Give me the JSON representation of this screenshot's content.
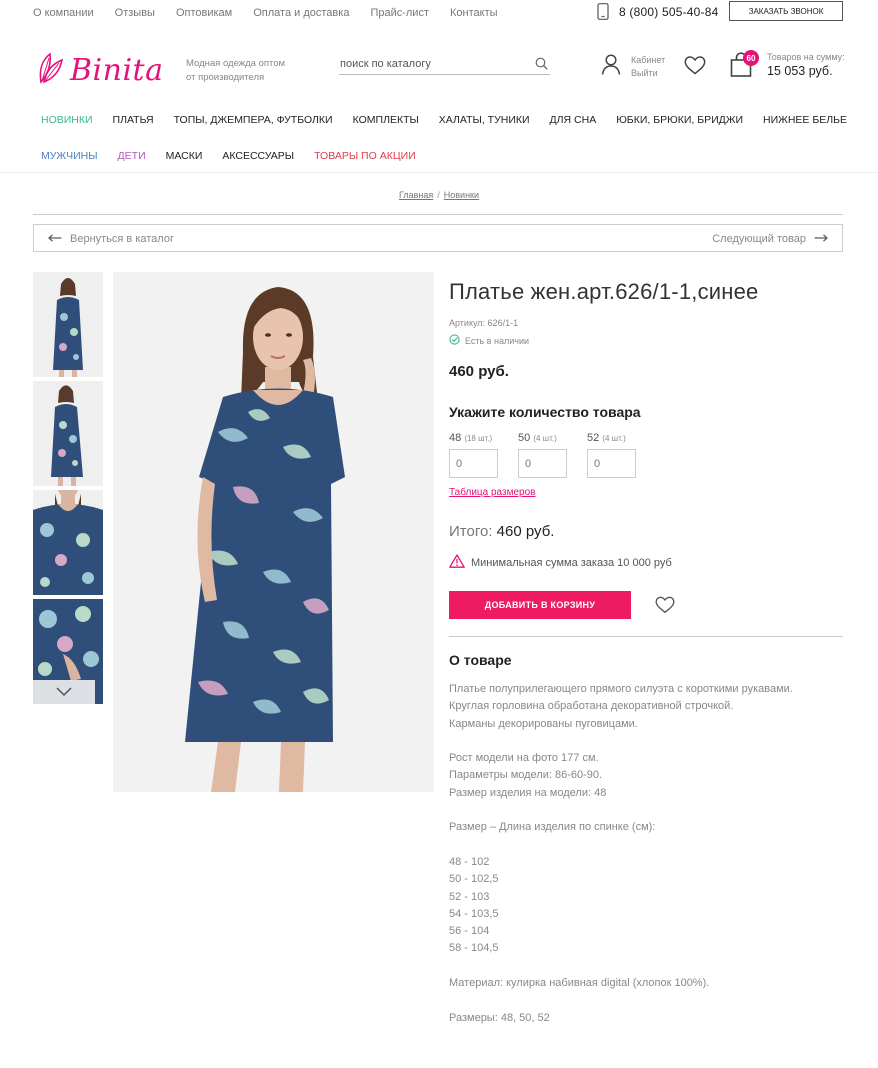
{
  "topbar": {
    "links": [
      "О компании",
      "Отзывы",
      "Оптовикам",
      "Оплата и доставка",
      "Прайс-лист",
      "Контакты"
    ],
    "phone": "8 (800) 505-40-84",
    "callback": "Заказать звонок"
  },
  "header": {
    "logo": "Binita",
    "tagline": "Модная одежда оптом от производителя",
    "search_placeholder": "поиск по каталогу",
    "cabinet": "Кабинет",
    "logout": "Выйти",
    "cart_count": "60",
    "cart_label": "Товаров на сумму:",
    "cart_sum": "15 053 руб."
  },
  "catnav": {
    "row1": [
      "Новинки",
      "Платья",
      "Топы, джемпера, футболки",
      "Комплекты",
      "Халаты, туники",
      "Для сна",
      "Юбки, брюки, бриджи",
      "Нижнее белье"
    ],
    "row2": [
      "Мужчины",
      "Дети",
      "Маски",
      "Аксессуары",
      "Товары по акции"
    ]
  },
  "breadcrumb": {
    "home": "Главная",
    "current": "Новинки"
  },
  "pager": {
    "back": "Вернуться в каталог",
    "next": "Следующий товар"
  },
  "product": {
    "title": "Платье жен.арт.626/1-1,синее",
    "article": "Артикул: 626/1-1",
    "stock": "Есть в наличии",
    "price": "460 руб.",
    "qty_title": "Укажите количество товара",
    "sizes": [
      {
        "size": "48",
        "stock": "(18 шт.)",
        "value": "0"
      },
      {
        "size": "50",
        "stock": "(4 шт.)",
        "value": "0"
      },
      {
        "size": "52",
        "stock": "(4 шт.)",
        "value": "0"
      }
    ],
    "size_table": "Таблица размеров",
    "total_label": "Итого:",
    "total_value": "460 руб.",
    "min_order": "Минимальная сумма заказа 10 000 руб",
    "add_to_cart": "Добавить в корзину",
    "about_title": "О товаре",
    "description": [
      "Платье полуприлегающего прямого силуэта с короткими рукавами.",
      "Круглая горловина обработана декоративной строчкой.",
      "Карманы декорированы пуговицами.",
      "",
      "Рост модели на фото 177 см.",
      "Параметры модели: 86-60-90.",
      "Размер изделия на модели: 48",
      "",
      "Размер – Длина изделия по спинке (см):",
      "",
      "48 - 102",
      "50 - 102,5",
      "52 - 103",
      "54 - 103,5",
      "56 - 104",
      "58 - 104,5",
      "",
      "Материал: кулирка набивная digital (хлопок 100%).",
      "",
      "Размеры: 48, 50, 52"
    ]
  },
  "colors": {
    "brand_pink": "#e6117a",
    "button_pink": "#ef1b62",
    "accent_green": "#3bb98a",
    "accent_blue": "#4a7fc1",
    "accent_purple": "#b05ab8",
    "accent_red": "#e03c4a",
    "dress_blue": "#2f4f7a"
  },
  "icons": {
    "phone": "phone-icon",
    "search": "search-icon",
    "user": "user-icon",
    "heart": "heart-icon",
    "bag": "shopping-bag-icon",
    "arrow_left": "arrow-left-icon",
    "arrow_right": "arrow-right-icon",
    "check": "check-circle-icon",
    "warning": "warning-icon",
    "chevron_down": "chevron-down-icon"
  }
}
